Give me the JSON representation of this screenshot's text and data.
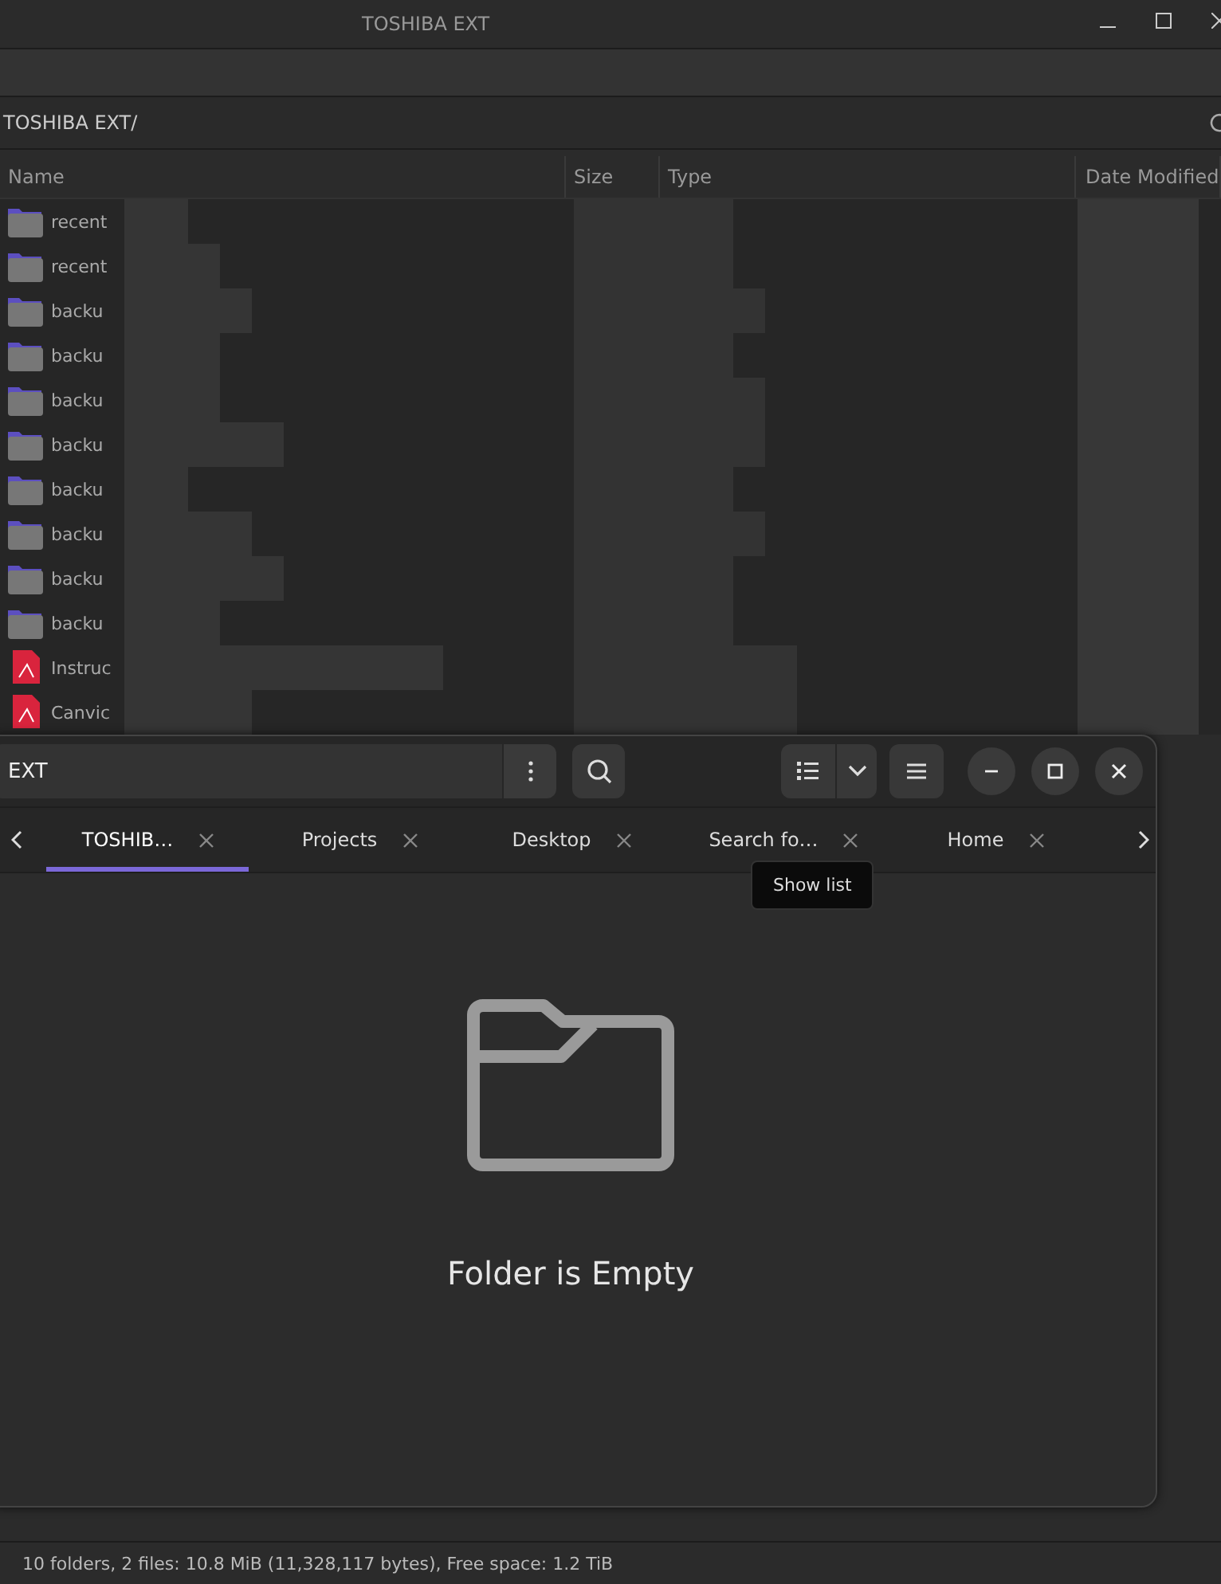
{
  "back_window": {
    "title": "TOSHIBA EXT",
    "path": "TOSHIBA EXT/",
    "columns": [
      "Name",
      "Size",
      "Type",
      "Date Modified"
    ],
    "rows": [
      {
        "kind": "folder",
        "name": "recent"
      },
      {
        "kind": "folder",
        "name": "recent"
      },
      {
        "kind": "folder",
        "name": "backu"
      },
      {
        "kind": "folder",
        "name": "backu"
      },
      {
        "kind": "folder",
        "name": "backu"
      },
      {
        "kind": "folder",
        "name": "backu"
      },
      {
        "kind": "folder",
        "name": "backu"
      },
      {
        "kind": "folder",
        "name": "backu"
      },
      {
        "kind": "folder",
        "name": "backu"
      },
      {
        "kind": "folder",
        "name": "backu"
      },
      {
        "kind": "pdf",
        "name": "Instruc"
      },
      {
        "kind": "pdf",
        "name": "Canvic"
      }
    ],
    "status_bar": "10 folders, 2 files: 10.8 MiB (11,328,117 bytes), Free space: 1.2 TiB"
  },
  "front_window": {
    "path": "EXT",
    "tabs": [
      {
        "label": "TOSHIB…",
        "selected": true
      },
      {
        "label": "Projects",
        "selected": false
      },
      {
        "label": "Desktop",
        "selected": false
      },
      {
        "label": "Search fo…",
        "selected": false
      },
      {
        "label": "Home",
        "selected": false
      }
    ],
    "tooltip": "Show list",
    "empty_message": "Folder is Empty"
  }
}
